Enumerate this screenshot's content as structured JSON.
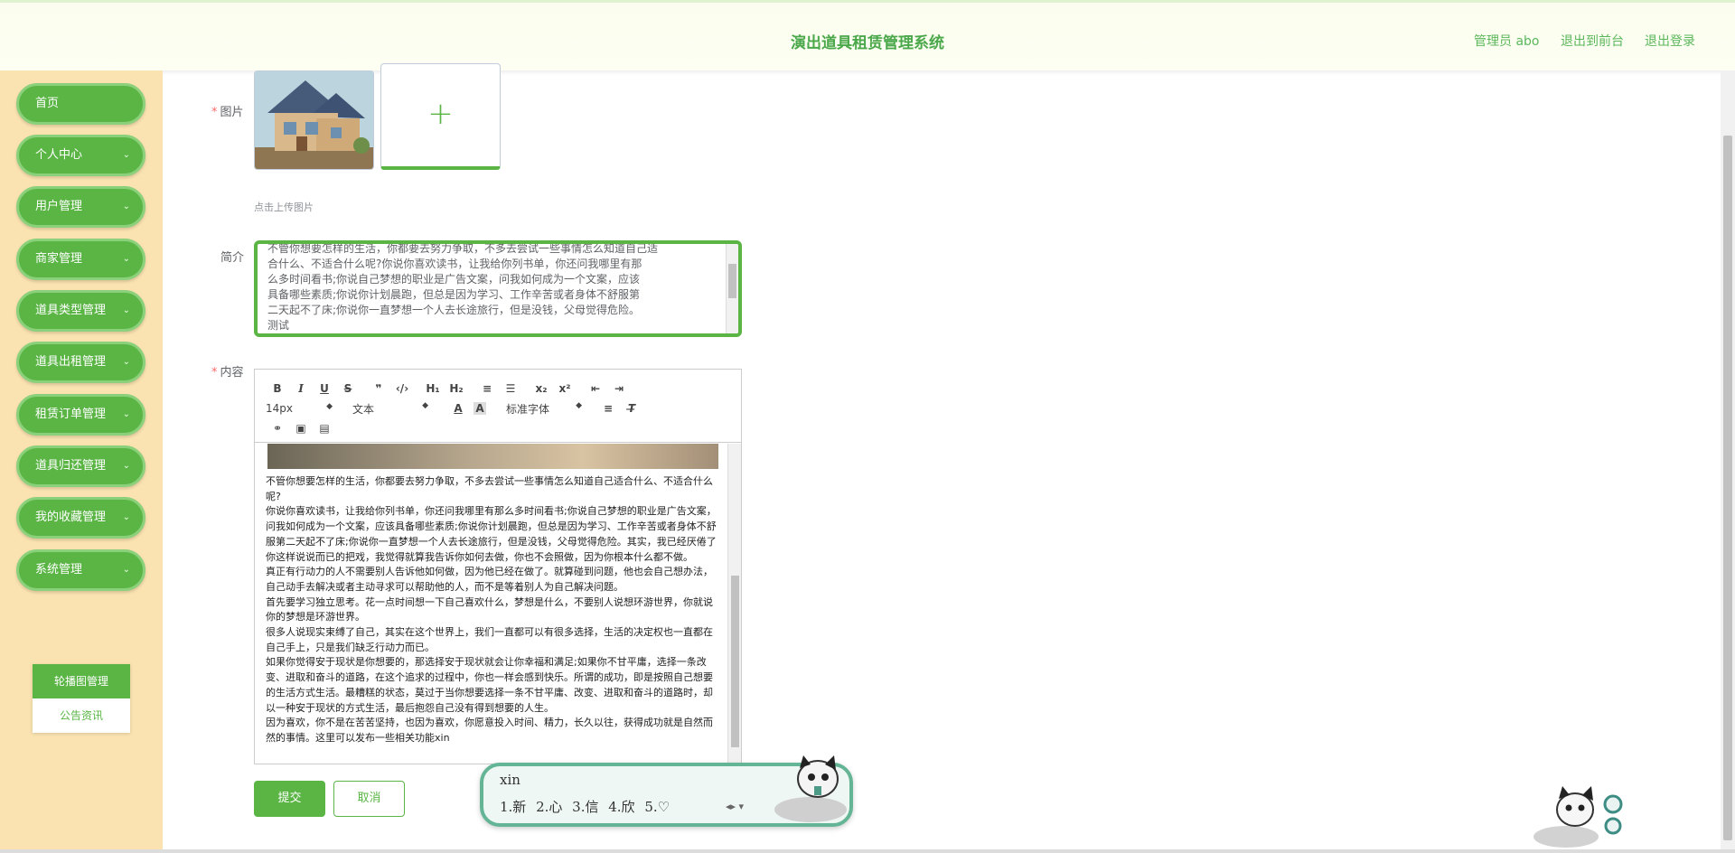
{
  "header": {
    "title": "演出道具租赁管理系统",
    "user_label": "管理员 abo",
    "to_front_label": "退出到前台",
    "logout_label": "退出登录"
  },
  "sidebar": {
    "items": [
      {
        "label": "首页",
        "has_children": false
      },
      {
        "label": "个人中心",
        "has_children": true
      },
      {
        "label": "用户管理",
        "has_children": true
      },
      {
        "label": "商家管理",
        "has_children": true
      },
      {
        "label": "道具类型管理",
        "has_children": true
      },
      {
        "label": "道具出租管理",
        "has_children": true
      },
      {
        "label": "租赁订单管理",
        "has_children": true
      },
      {
        "label": "道具归还管理",
        "has_children": true
      },
      {
        "label": "我的收藏管理",
        "has_children": true
      },
      {
        "label": "系统管理",
        "has_children": true
      }
    ],
    "submenu": [
      {
        "label": "轮播图管理",
        "active": true
      },
      {
        "label": "公告资讯",
        "active": false
      }
    ]
  },
  "form": {
    "image_label": "图片",
    "upload_tip": "点击上传图片",
    "intro_label": "简介",
    "intro_lines": [
      "不管你想要怎样的生活，你都要去努力争取，不多去尝试一些事情怎么知道自己适",
      "合什么、不适合什么呢?你说你喜欢读书，让我给你列书单，你还问我哪里有那",
      "么多时间看书;你说自己梦想的职业是广告文案，问我如何成为一个文案，应该",
      "具备哪些素质;你说你计划晨跑，但总是因为学习、工作辛苦或者身体不舒服第",
      "二天起不了床;你说你一直梦想一个人去长途旅行，但是没钱，父母觉得危险。",
      "测试"
    ],
    "content_label": "内容",
    "toolbar": {
      "font_size": "14px",
      "block_type": "文本",
      "font_family": "标准字体",
      "buttons": [
        "B",
        "I",
        "U",
        "S",
        "❞",
        "‹/›",
        "H₁",
        "H₂",
        "≡",
        "☰",
        "x₂",
        "x²",
        "⇤",
        "⇥"
      ]
    },
    "content_paragraphs": [
      "不管你想要怎样的生活，你都要去努力争取，不多去尝试一些事情怎么知道自己适合什么、不适合什么呢?",
      "你说你喜欢读书，让我给你列书单，你还问我哪里有那么多时间看书;你说自己梦想的职业是广告文案，问我如何成为一个文案，应该具备哪些素质;你说你计划晨跑，但总是因为学习、工作辛苦或者身体不舒服第二天起不了床;你说你一直梦想一个人去长途旅行，但是没钱，父母觉得危险。其实，我已经厌倦了你这样说说而已的把戏，我觉得就算我告诉你如何去做，你也不会照做，因为你根本什么都不做。",
      "真正有行动力的人不需要别人告诉他如何做，因为他已经在做了。就算碰到问题，他也会自己想办法，自己动手去解决或者主动寻求可以帮助他的人，而不是等着别人为自己解决问题。",
      "首先要学习独立思考。花一点时间想一下自己喜欢什么，梦想是什么，不要别人说想环游世界，你就说你的梦想是环游世界。",
      "很多人说现实束缚了自己，其实在这个世界上，我们一直都可以有很多选择，生活的决定权也一直都在自己手上，只是我们缺乏行动力而已。",
      "如果你觉得安于现状是你想要的，那选择安于现状就会让你幸福和满足;如果你不甘平庸，选择一条改变、进取和奋斗的道路，在这个追求的过程中，你也一样会感到快乐。所谓的成功，即是按照自己想要的生活方式生活。最糟糕的状态，莫过于当你想要选择一条不甘平庸、改变、进取和奋斗的道路时，却以一种安于现状的方式生活，最后抱怨自己没有得到想要的人生。",
      "因为喜欢，你不是在苦苦坚持，也因为喜欢，你愿意投入时间、精力，长久以往，获得成功就是自然而然的事情。这里可以发布一些相关功能xin"
    ],
    "submit_label": "提交",
    "cancel_label": "取消"
  },
  "ime": {
    "composition": "xin",
    "candidates": "1.新  2.心  3.信  4.欣  5.♡"
  },
  "colors": {
    "accent": "#5ab545",
    "sidebar_bg": "#fbe3b1",
    "header_title": "#4aa84a"
  }
}
